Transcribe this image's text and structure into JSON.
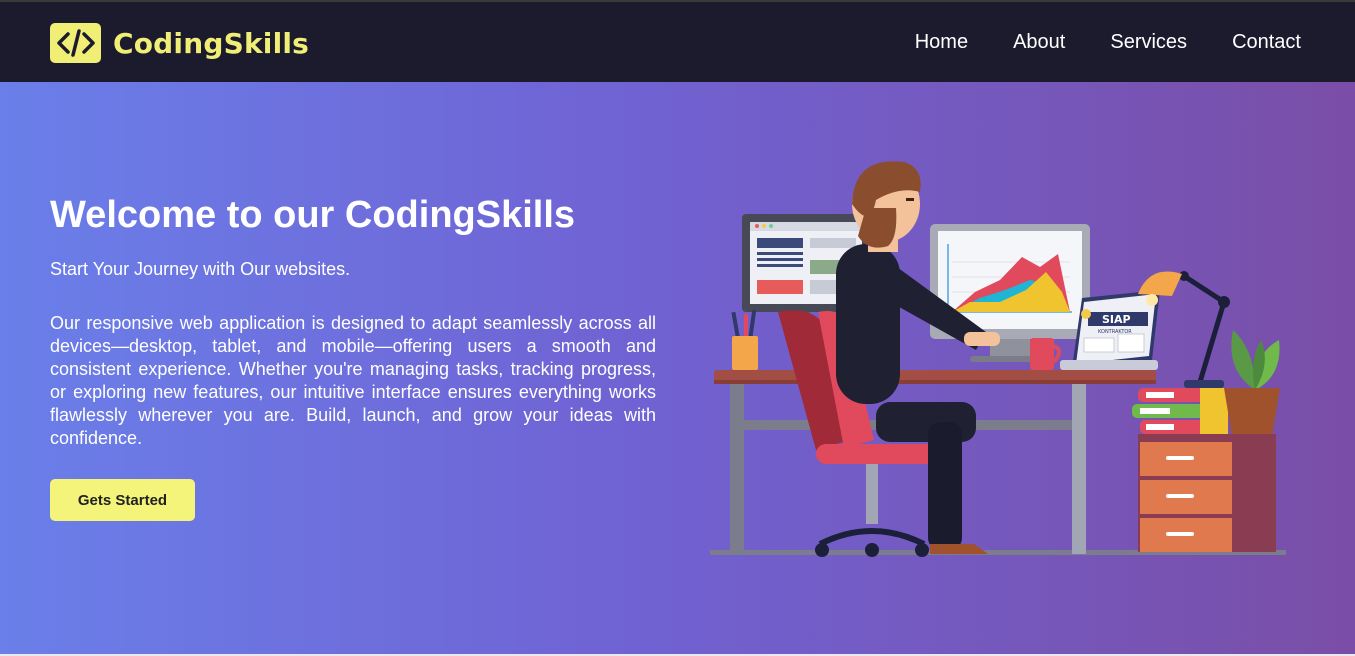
{
  "header": {
    "brand": "CodingSkills",
    "logo_icon": "code-brackets-icon",
    "nav": [
      "Home",
      "About",
      "Services",
      "Contact"
    ]
  },
  "hero": {
    "title": "Welcome to our CodingSkills",
    "subtitle": "Start Your Journey with Our websites.",
    "description": "Our responsive web application is designed to adapt seamlessly across all devices—desktop, tablet, and mobile—offering users a smooth and consistent experience. Whether you're managing tasks, tracking progress, or exploring new features, our intuitive interface ensures everything works flawlessly wherever you are. Build, launch, and grow your ideas with confidence.",
    "cta_label": "Gets Started"
  },
  "illustration": {
    "laptop_label_1": "SIAP",
    "laptop_label_2": "KONTRAKTOR"
  },
  "colors": {
    "navbar_bg": "#1c1b2e",
    "brand_accent": "#f0ee74",
    "hero_gradient_start": "#6a7fe9",
    "hero_gradient_end": "#7a4ea7",
    "cta_bg": "#f4f47a"
  }
}
